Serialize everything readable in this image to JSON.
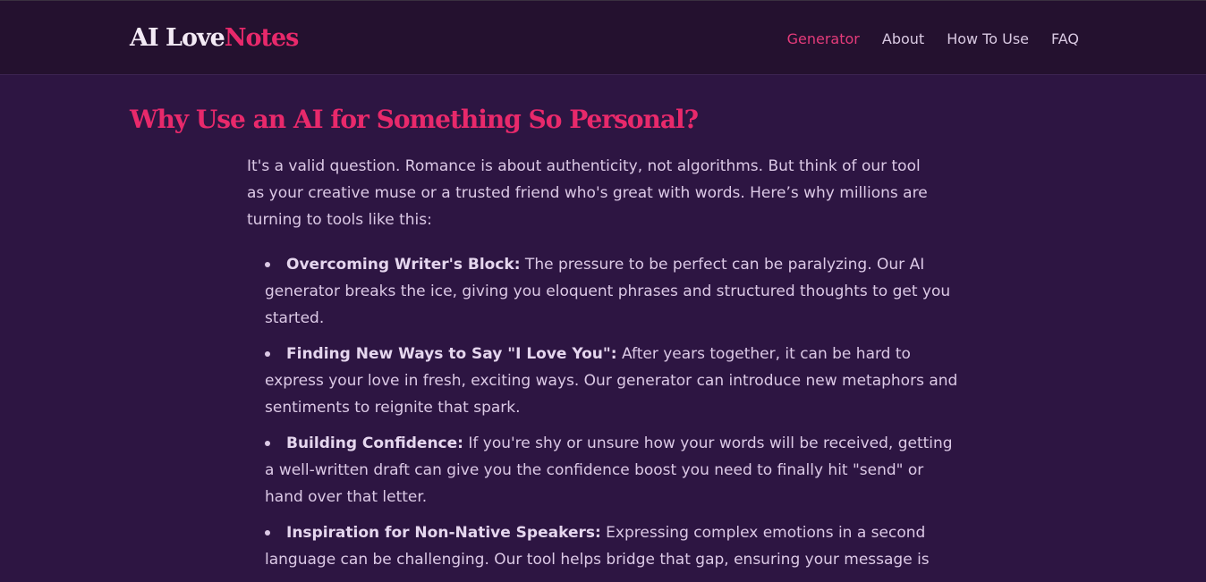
{
  "header": {
    "logo_main": "AI Love",
    "logo_accent": "Notes",
    "nav": [
      {
        "label": "Generator",
        "active": true
      },
      {
        "label": "About",
        "active": false
      },
      {
        "label": "How To Use",
        "active": false
      },
      {
        "label": "FAQ",
        "active": false
      }
    ]
  },
  "section": {
    "title": "Why Use an AI for Something So Personal?",
    "intro": "It's a valid question. Romance is about authenticity, not algorithms. But think of our tool as your creative muse or a trusted friend who's great with words. Here’s why millions are turning to tools like this:",
    "points": [
      {
        "term": "Overcoming Writer's Block:",
        "text": " The pressure to be perfect can be paralyzing. Our AI generator breaks the ice, giving you eloquent phrases and structured thoughts to get you started."
      },
      {
        "term": "Finding New Ways to Say \"I Love You\":",
        "text": " After years together, it can be hard to express your love in fresh, exciting ways. Our generator can introduce new metaphors and sentiments to reignite that spark."
      },
      {
        "term": "Building Confidence:",
        "text": " If you're shy or unsure how your words will be received, getting a well-written draft can give you the confidence boost you need to finally hit \"send\" or hand over that letter."
      },
      {
        "term": "Inspiration for Non-Native Speakers:",
        "text": " Expressing complex emotions in a second language can be challenging. Our tool helps bridge that gap, ensuring your message is"
      }
    ]
  },
  "colors": {
    "background": "#2d1542",
    "header_bg": "#24112f",
    "accent": "#e8296b",
    "text": "#dcc9e6"
  }
}
